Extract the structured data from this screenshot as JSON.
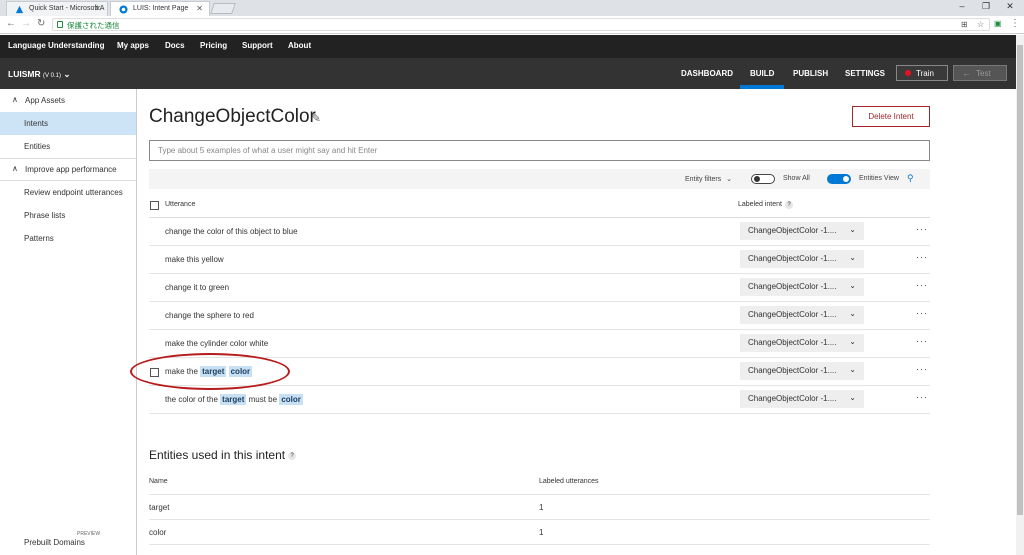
{
  "browser": {
    "tabs": [
      {
        "title": "Quick Start - Microsoft A",
        "active": false
      },
      {
        "title": "LUIS: Intent Page",
        "active": true
      }
    ],
    "secure_text": "保護された通信",
    "url": "",
    "window_controls": [
      "–",
      "❐",
      "✕"
    ]
  },
  "topnav": {
    "brand": "Language Understanding",
    "links": [
      "My apps",
      "Docs",
      "Pricing",
      "Support",
      "About"
    ]
  },
  "subnav": {
    "app_name": "LUISMR",
    "app_version": "(V 0.1)",
    "tabs": [
      "DASHBOARD",
      "BUILD",
      "PUBLISH",
      "SETTINGS"
    ],
    "active_tab": "BUILD",
    "train_label": "Train",
    "test_label": "Test"
  },
  "sidebar": {
    "sections": [
      {
        "label": "App Assets",
        "items": [
          "Intents",
          "Entities"
        ]
      },
      {
        "label": "Improve app performance",
        "items": [
          "Review endpoint utterances",
          "Phrase lists",
          "Patterns"
        ]
      }
    ],
    "active_item": "Intents",
    "prebuilt_label": "Prebuilt Domains",
    "preview_label": "PREVIEW"
  },
  "main": {
    "intent_title": "ChangeObjectColor",
    "delete_label": "Delete Intent",
    "utterance_placeholder": "Type about 5 examples of what a user might say and hit Enter",
    "filters": {
      "entity_filters_label": "Entity filters",
      "show_all_label": "Show All",
      "show_all_on": false,
      "entities_view_label": "Entities View",
      "entities_view_on": true
    },
    "table": {
      "col_utterance": "Utterance",
      "col_intent": "Labeled intent",
      "help": "?",
      "more": "···",
      "rows": [
        {
          "text": "change the color of this object to blue",
          "intent": "ChangeObjectColor -1...."
        },
        {
          "text": "make this yellow",
          "intent": "ChangeObjectColor -1...."
        },
        {
          "text": "change it to green",
          "intent": "ChangeObjectColor -1...."
        },
        {
          "text": "change the sphere to red",
          "intent": "ChangeObjectColor -1...."
        },
        {
          "text": "make the cylinder color white",
          "intent": "ChangeObjectColor -1...."
        },
        {
          "pre": "make the",
          "ent1": "target",
          "ent2": "color",
          "intent": "ChangeObjectColor -1...."
        },
        {
          "pre": "the color of the",
          "ent1": "target",
          "mid": "must be",
          "ent2": "color",
          "intent": "ChangeObjectColor -1...."
        }
      ]
    },
    "entities_section": {
      "title": "Entities used in this intent",
      "col_name": "Name",
      "col_count": "Labeled utterances",
      "rows": [
        {
          "name": "target",
          "count": "1"
        },
        {
          "name": "color",
          "count": "1"
        }
      ]
    }
  },
  "colors": {
    "accent": "#0078d7",
    "topnav_bg": "#222222",
    "subnav_bg": "#333333",
    "entity_highlight": "#c7e0f4",
    "delete_red": "#a4262c",
    "annotation_circle": "#b71c1c"
  }
}
